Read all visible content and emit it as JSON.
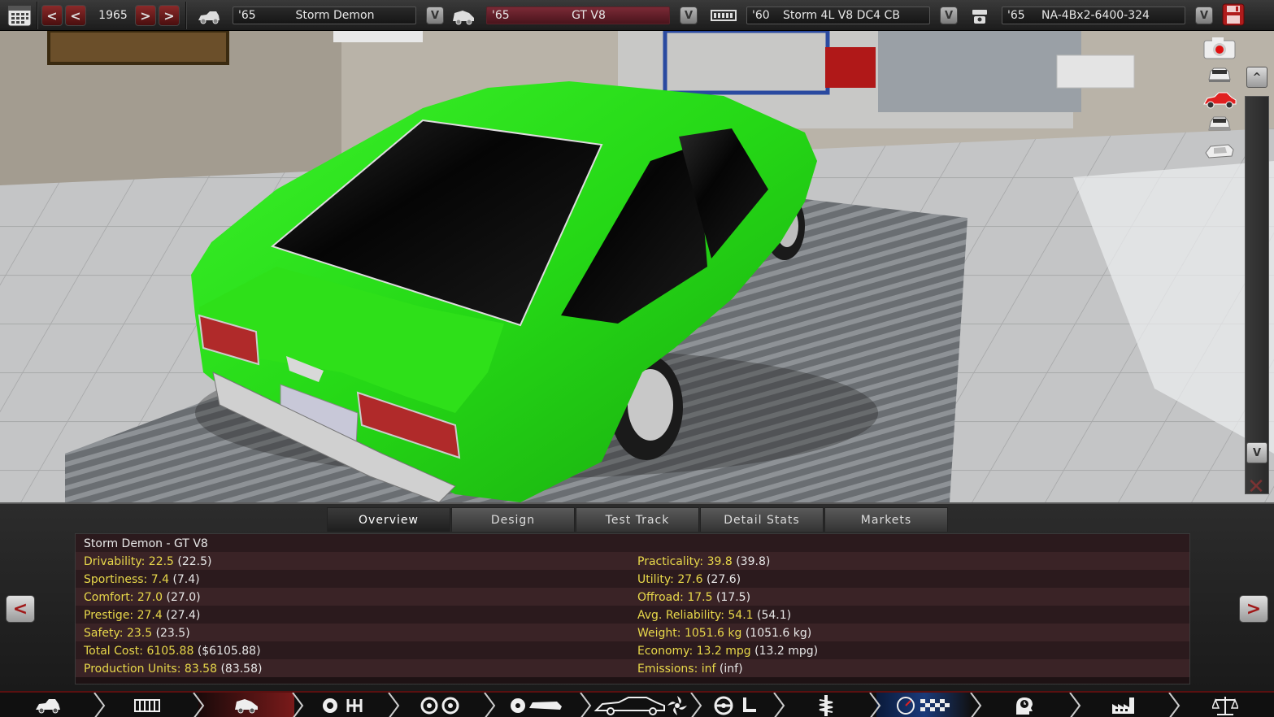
{
  "topbar": {
    "year": "1965",
    "model": {
      "year": "'65",
      "name": "Storm Demon"
    },
    "trim": {
      "year": "'65",
      "name": "GT V8"
    },
    "engine": {
      "year": "'60",
      "name": "Storm 4L V8 DC4 CB"
    },
    "variant": {
      "year": "'65",
      "name": "NA-4Bx2-6400-324"
    },
    "prev_label": "<",
    "next_label": ">",
    "dropdown_label": "V"
  },
  "sidebar": {
    "scroll_up_label": "^",
    "scroll_down_label": "V",
    "icons": [
      "camera-icon",
      "car-front-icon",
      "car-side-red-icon",
      "car-rear-icon",
      "car-top-icon"
    ]
  },
  "tabs": [
    {
      "label": "Overview",
      "active": true
    },
    {
      "label": "Design",
      "active": false
    },
    {
      "label": "Test Track",
      "active": false
    },
    {
      "label": "Detail Stats",
      "active": false
    },
    {
      "label": "Markets",
      "active": false
    }
  ],
  "overview": {
    "title": "Storm Demon - GT V8",
    "left": [
      {
        "key": "Drivability:",
        "value": "22.5",
        "paren": "(22.5)"
      },
      {
        "key": "Sportiness:",
        "value": "7.4",
        "paren": "(7.4)"
      },
      {
        "key": "Comfort:",
        "value": "27.0",
        "paren": "(27.0)"
      },
      {
        "key": "Prestige:",
        "value": "27.4",
        "paren": "(27.4)"
      },
      {
        "key": "Safety:",
        "value": "23.5",
        "paren": "(23.5)"
      },
      {
        "key": "Total Cost:",
        "value": "6105.88",
        "paren": "($6105.88)"
      },
      {
        "key": "Production Units:",
        "value": "83.58",
        "paren": "(83.58)"
      }
    ],
    "right": [
      {
        "key": "Practicality:",
        "value": "39.8",
        "paren": "(39.8)"
      },
      {
        "key": "Utility:",
        "value": "27.6",
        "paren": "(27.6)"
      },
      {
        "key": "Offroad:",
        "value": "17.5",
        "paren": "(17.5)"
      },
      {
        "key": "Avg. Reliability:",
        "value": "54.1",
        "paren": "(54.1)"
      },
      {
        "key": "Weight:",
        "value": "1051.6 kg",
        "paren": "(1051.6 kg)"
      },
      {
        "key": "Economy:",
        "value": "13.2 mpg",
        "paren": "(13.2 mpg)"
      },
      {
        "key": "Emissions:",
        "value": "inf",
        "paren": "(inf)"
      }
    ],
    "prev_label": "<",
    "next_label": ">"
  },
  "navbar": {
    "items": [
      "car-model-icon",
      "chassis-icon",
      "trim-icon",
      "engine-gearbox-icon",
      "wheels-icon",
      "body-design-icon",
      "car-design-icon",
      "fans-icon",
      "interior-icon",
      "suspension-icon",
      "testing-icon",
      "time-icon",
      "factory-icon",
      "balance-icon"
    ]
  },
  "colors": {
    "car": "#2ee019",
    "accent_red": "#8a1a1a",
    "stat_yellow": "#e8d84a"
  }
}
